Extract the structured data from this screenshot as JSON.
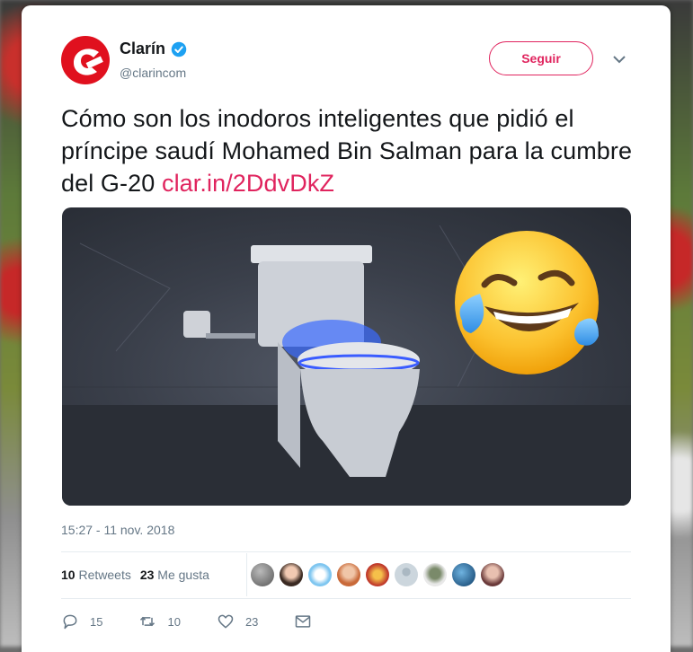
{
  "account": {
    "name": "Clarín",
    "handle": "@clarincom",
    "follow_label": "Seguir"
  },
  "tweet": {
    "text": "Cómo son los inodoros inteligentes que pidió el príncipe saudí Mohamed Bin Salman para la cumbre del G-20 ",
    "link": "clar.in/2DdvDkZ",
    "timestamp": "15:27 - 11 nov. 2018"
  },
  "stats": {
    "retweets_count": "10",
    "retweets_label": "Retweets",
    "likes_count": "23",
    "likes_label": "Me gusta"
  },
  "actions": {
    "replies": "15",
    "retweets": "10",
    "likes": "23"
  },
  "media": {
    "description_icons": [
      "toilet-photo",
      "laughing-tears-emoji"
    ]
  },
  "colors": {
    "accent": "#e0245e",
    "verified": "#1da1f2",
    "brand": "#e0101e",
    "text_secondary": "#657786"
  }
}
